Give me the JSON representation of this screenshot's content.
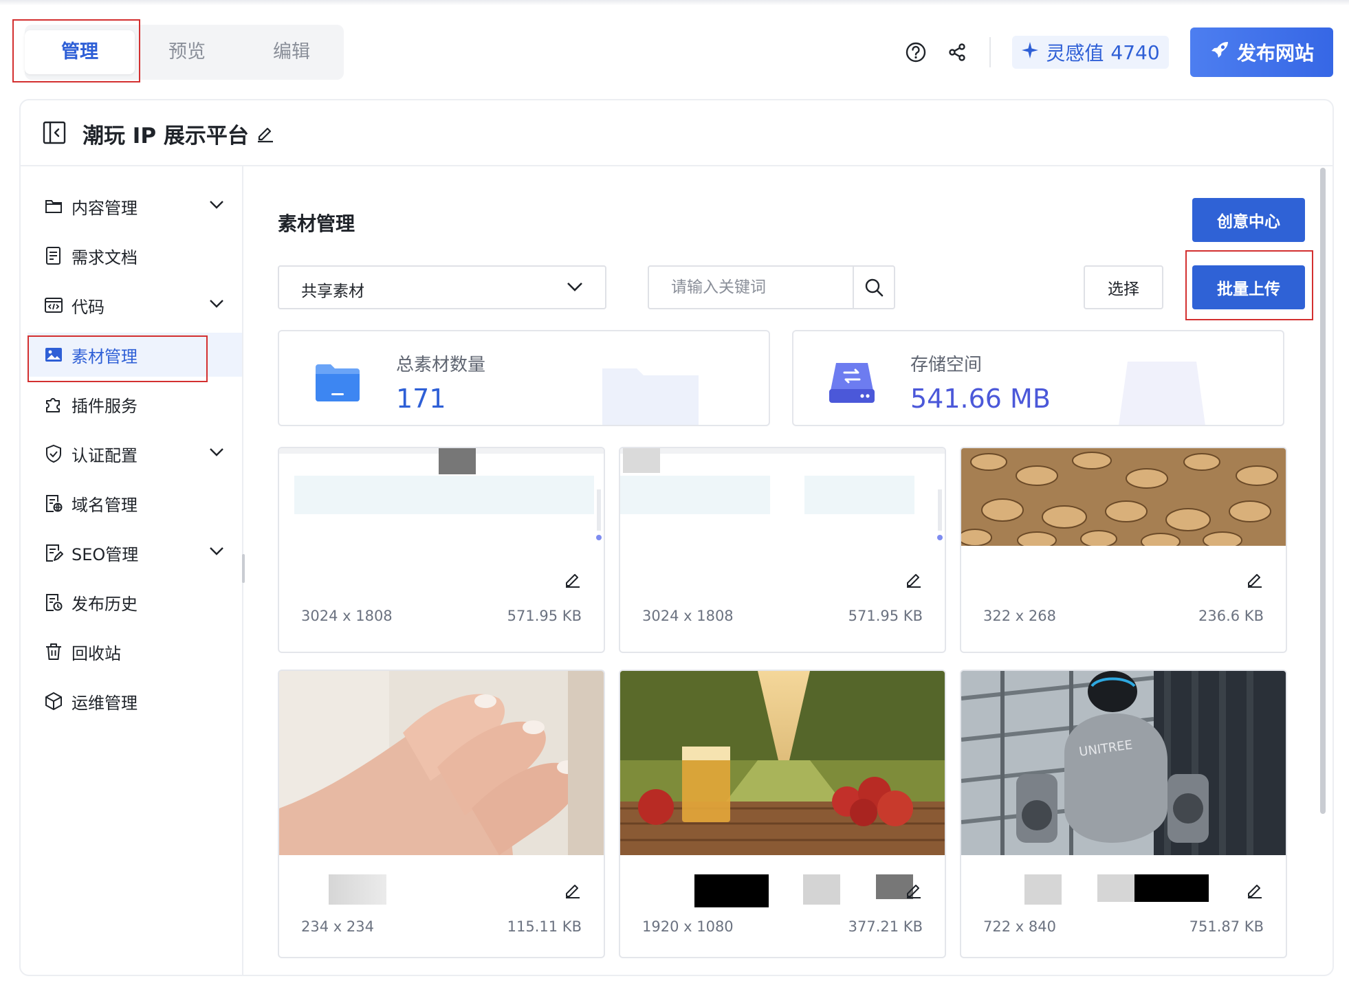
{
  "top": {
    "tabs": [
      {
        "label": "管理",
        "active": true
      },
      {
        "label": "预览",
        "active": false
      },
      {
        "label": "编辑",
        "active": false
      }
    ],
    "inspiration_label": "灵感值",
    "inspiration_value": "4740",
    "publish_label": "发布网站"
  },
  "site": {
    "title": "潮玩 IP 展示平台"
  },
  "sidebar": {
    "items": [
      {
        "label": "内容管理",
        "icon": "folder-icon",
        "expandable": true
      },
      {
        "label": "需求文档",
        "icon": "document-icon",
        "expandable": false
      },
      {
        "label": "代码",
        "icon": "code-icon",
        "expandable": true
      },
      {
        "label": "素材管理",
        "icon": "image-icon",
        "expandable": false,
        "active": true
      },
      {
        "label": "插件服务",
        "icon": "puzzle-icon",
        "expandable": false
      },
      {
        "label": "认证配置",
        "icon": "shield-check-icon",
        "expandable": true
      },
      {
        "label": "域名管理",
        "icon": "domain-doc-icon",
        "expandable": false
      },
      {
        "label": "SEO管理",
        "icon": "seo-doc-icon",
        "expandable": true
      },
      {
        "label": "发布历史",
        "icon": "history-doc-icon",
        "expandable": false
      },
      {
        "label": "回收站",
        "icon": "trash-icon",
        "expandable": false
      },
      {
        "label": "运维管理",
        "icon": "cube-icon",
        "expandable": false
      }
    ]
  },
  "main": {
    "section_title": "素材管理",
    "creative_center_label": "创意中心",
    "filter_value": "共享素材",
    "search_placeholder": "请输入关键词",
    "select_label": "选择",
    "bulk_upload_label": "批量上传",
    "stats": [
      {
        "label": "总素材数量",
        "value": "171"
      },
      {
        "label": "存储空间",
        "value": "541.66 MB"
      }
    ],
    "assets": [
      {
        "dims": "3024 x 1808",
        "size": "571.95 KB",
        "thumb": "screenshot"
      },
      {
        "dims": "3024 x 1808",
        "size": "571.95 KB",
        "thumb": "screenshot"
      },
      {
        "dims": "322 x 268",
        "size": "236.6 KB",
        "thumb": "mushrooms"
      },
      {
        "dims": "234 x 234",
        "size": "115.11 KB",
        "thumb": "hand"
      },
      {
        "dims": "1920 x 1080",
        "size": "377.21 KB",
        "thumb": "apples-orchard"
      },
      {
        "dims": "722 x 840",
        "size": "751.87 KB",
        "thumb": "robot"
      }
    ]
  },
  "colors": {
    "accent": "#2e5fd6",
    "primary_button": "#2f62d6",
    "highlight_box": "#d32f2f",
    "active_nav_bg": "#eef3fd"
  }
}
